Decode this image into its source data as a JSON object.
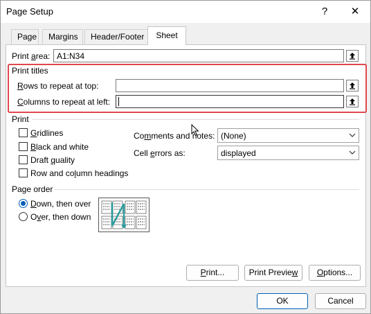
{
  "window": {
    "title": "Page Setup",
    "help_glyph": "?",
    "close_glyph": "✕"
  },
  "tabs": [
    {
      "label": "Page",
      "active": false
    },
    {
      "label": "Margins",
      "active": false
    },
    {
      "label": "Header/Footer",
      "active": false
    },
    {
      "label": "Sheet",
      "active": true
    }
  ],
  "print_area": {
    "label_pre": "Print ",
    "label_key": "a",
    "label_post": "rea:",
    "value": "A1:N34"
  },
  "print_titles": {
    "heading": "Print titles",
    "rows_label_key": "R",
    "rows_label_rest": "ows to repeat at top:",
    "rows_value": "",
    "cols_label_key": "C",
    "cols_label_rest": "olumns to repeat at left:",
    "cols_value": ""
  },
  "print_section": {
    "heading": "Print",
    "checkboxes": [
      {
        "key": "G",
        "rest": "ridlines",
        "checked": false
      },
      {
        "key": "B",
        "rest": "lack and white",
        "checked": false
      },
      {
        "pre": "Draft ",
        "key": "q",
        "rest": "uality",
        "checked": false
      },
      {
        "pre": "Row and co",
        "key": "l",
        "rest": "umn headings",
        "checked": false
      }
    ],
    "comments_label_pre": "Co",
    "comments_label_key": "m",
    "comments_label_rest": "ments and notes:",
    "comments_value": "(None)",
    "cell_errors_label_pre": "Cell ",
    "cell_errors_label_key": "e",
    "cell_errors_label_rest": "rrors as:",
    "cell_errors_value": "displayed"
  },
  "page_order": {
    "heading": "Page order",
    "options": [
      {
        "key": "D",
        "rest": "own, then over",
        "checked": true
      },
      {
        "pre": "O",
        "key": "v",
        "rest": "er, then down",
        "checked": false
      }
    ]
  },
  "buttons": {
    "print_pre": "",
    "print_key": "P",
    "print_rest": "rint...",
    "preview_pre": "Print Previe",
    "preview_key": "w",
    "preview_rest": "",
    "options_pre": "",
    "options_key": "O",
    "options_rest": "ptions...",
    "ok": "OK",
    "cancel": "Cancel"
  },
  "colors": {
    "highlight": "#e0474c",
    "accent": "#005fb8",
    "diagram_arrow": "#2a9d9d"
  }
}
